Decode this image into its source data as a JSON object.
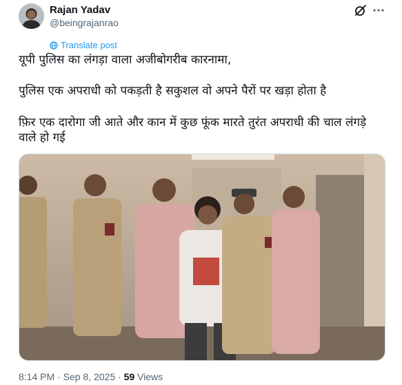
{
  "user": {
    "name": "Rajan Yadav",
    "handle": "@beingrajanrao"
  },
  "translate_label": "Translate post",
  "body": {
    "line1": "यूपी पुलिस का  लंगड़ा वाला अजीबोगरीब कारनामा,",
    "line2": "पुलिस एक अपराधी को पकड़ती है सकुशल वो अपने पैरों पर खड़ा होता है",
    "line3": "फ़िर एक दारोगा जी आते और कान में कुछ फूंक मारते तुरंत अपराधी की चाल लंगड़े वाले हो गई"
  },
  "meta": {
    "time": "8:14 PM",
    "sep1": " · ",
    "date": "Sep 8, 2025",
    "sep2": " · ",
    "views_count": "59",
    "views_label": " Views"
  },
  "colors": {
    "link": "#1d9bf0",
    "secondary": "#536471",
    "text": "#0f1419"
  },
  "icons": [
    "grok-icon",
    "more-icon",
    "translate-icon"
  ]
}
